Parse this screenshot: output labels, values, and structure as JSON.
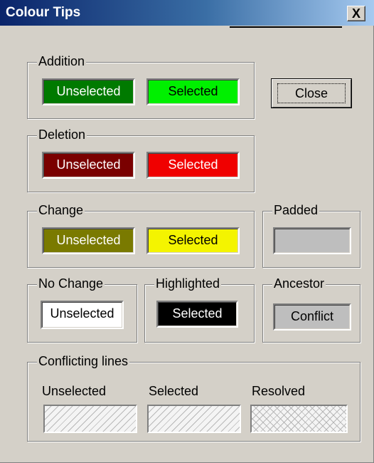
{
  "window": {
    "title": "Colour Tips",
    "close_glyph": "X"
  },
  "close_button": {
    "label": "Close"
  },
  "groups": {
    "addition": {
      "title": "Addition",
      "unselected": "Unselected",
      "selected": "Selected"
    },
    "deletion": {
      "title": "Deletion",
      "unselected": "Unselected",
      "selected": "Selected"
    },
    "change": {
      "title": "Change",
      "unselected": "Unselected",
      "selected": "Selected"
    },
    "padded": {
      "title": "Padded"
    },
    "no_change": {
      "title": "No Change",
      "unselected": "Unselected"
    },
    "highlighted": {
      "title": "Highlighted",
      "selected": "Selected"
    },
    "ancestor": {
      "title": "Ancestor",
      "conflict": "Conflict"
    },
    "conflicting": {
      "title": "Conflicting lines",
      "unselected": "Unselected",
      "selected": "Selected",
      "resolved": "Resolved"
    }
  },
  "colors": {
    "addition_unselected": "#007a00",
    "addition_selected": "#00f000",
    "deletion_unselected": "#7a0000",
    "deletion_selected": "#f00000",
    "change_unselected": "#7a7a00",
    "change_selected": "#f4f400",
    "padded": "#bebebe",
    "no_change": "#ffffff",
    "highlighted": "#000000",
    "ancestor": "#bebebe"
  }
}
